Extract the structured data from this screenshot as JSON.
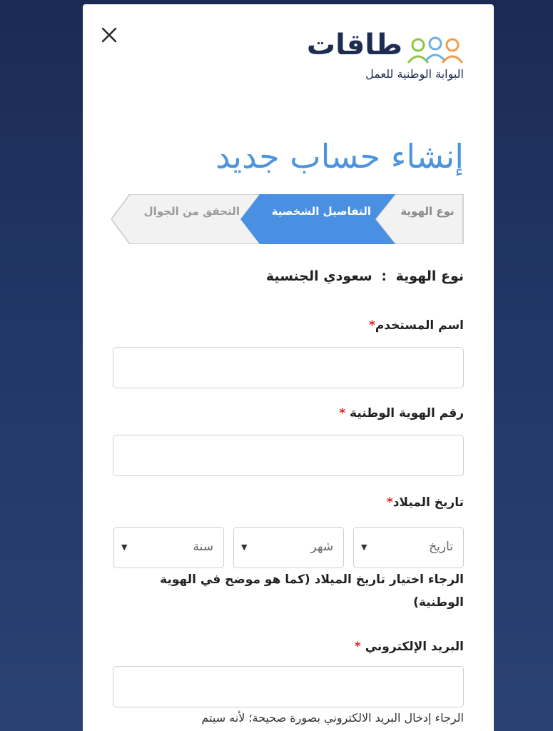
{
  "logo": {
    "name": "طاقات",
    "subtitle": "البوابة الوطنية للعمل",
    "people_colors": [
      "#8cc63f",
      "#6bb0e0",
      "#f39c4a"
    ]
  },
  "close": {
    "icon": "close-icon"
  },
  "title": "إنشاء حساب جديد",
  "steps": [
    {
      "label": "نوع الهوية",
      "state": "completed"
    },
    {
      "label": "التفاصيل الشخصية",
      "state": "active"
    },
    {
      "label": "التحقق من الجوال",
      "state": "upcoming"
    }
  ],
  "id_type": {
    "label": "نوع الهوية",
    "separator": ":",
    "value": "سعودي الجنسية"
  },
  "fields": {
    "username": {
      "label": "اسم المستخدم",
      "required_mark": "*",
      "value": ""
    },
    "national_id": {
      "label": "رقم الهوية الوطنية",
      "required_mark": "*",
      "value": ""
    },
    "dob": {
      "label": "تاريخ الميلاد",
      "required_mark": "*",
      "day_placeholder": "تاريخ",
      "month_placeholder": "شهر",
      "year_placeholder": "سنة",
      "help": "الرجاء اختيار تاريخ الميلاد (كما هو موضح في الهوية الوطنية)"
    },
    "email": {
      "label": "البريد الإلكتروني",
      "required_mark": "*",
      "value": "",
      "help": "الرجاء إدخال البريد الالكتروني بصورة صحيحة؛ لأنه سيتم"
    }
  },
  "colors": {
    "accent": "#4a90e2",
    "title": "#4c94dd",
    "step_inactive_bg": "#f2f2f2",
    "step_border": "#c8c8c8",
    "required": "#e02020",
    "background": "#1b2a55"
  }
}
